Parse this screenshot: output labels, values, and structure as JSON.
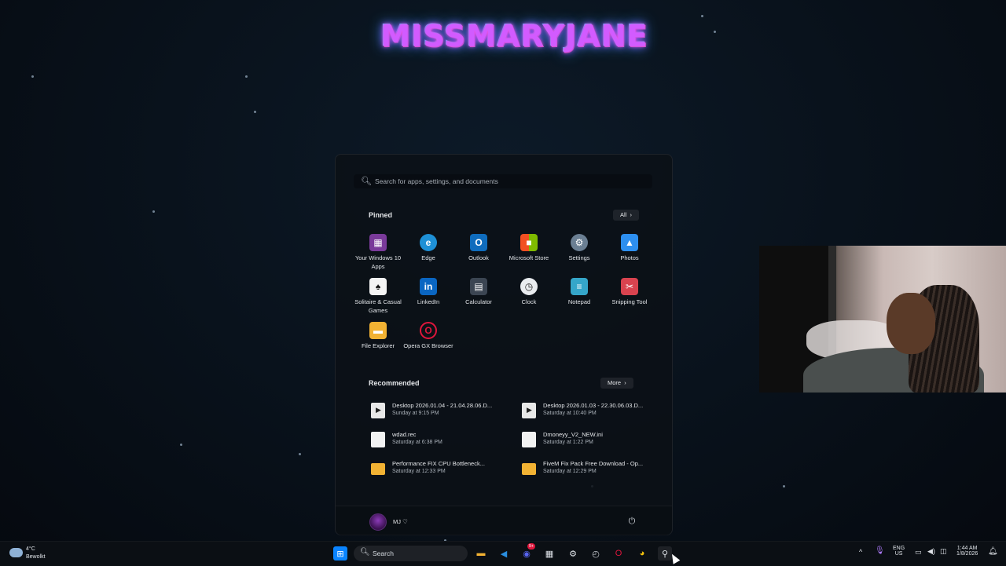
{
  "stream_title": "MISSMARYJANE",
  "start_menu": {
    "search": {
      "placeholder": "Search for apps, settings, and documents"
    },
    "pinned": {
      "title": "Pinned",
      "all_label": "All",
      "apps": [
        {
          "label": "Your Windows 10 Apps",
          "icon": "windows-apps-icon",
          "color": "#7a3a9a"
        },
        {
          "label": "Edge",
          "icon": "edge-icon",
          "color": "#1e90d6"
        },
        {
          "label": "Outlook",
          "icon": "outlook-icon",
          "color": "#0f6cbd"
        },
        {
          "label": "Microsoft Store",
          "icon": "store-icon",
          "color": "#f25022"
        },
        {
          "label": "Settings",
          "icon": "gear-icon",
          "color": "#6b7f93"
        },
        {
          "label": "Photos",
          "icon": "photos-icon",
          "color": "#2d8ff0"
        },
        {
          "label": "Solitaire & Casual Games",
          "icon": "solitaire-icon",
          "color": "#1f6e3a"
        },
        {
          "label": "LinkedIn",
          "icon": "linkedin-icon",
          "color": "#0a66c2"
        },
        {
          "label": "Calculator",
          "icon": "calculator-icon",
          "color": "#3b4552"
        },
        {
          "label": "Clock",
          "icon": "clock-icon",
          "color": "#5f6670"
        },
        {
          "label": "Notepad",
          "icon": "notepad-icon",
          "color": "#35a6c9"
        },
        {
          "label": "Snipping Tool",
          "icon": "snipping-tool-icon",
          "color": "#d9434f"
        },
        {
          "label": "File Explorer",
          "icon": "folder-icon",
          "color": "#f2b233"
        },
        {
          "label": "Opera GX Browser",
          "icon": "opera-gx-icon",
          "color": "#e0163c"
        }
      ]
    },
    "recommended": {
      "title": "Recommended",
      "more_label": "More",
      "items": [
        {
          "name": "Desktop 2026.01.04 - 21.04.28.06.D...",
          "time": "Sunday at 9:15 PM",
          "icon": "video-file-icon"
        },
        {
          "name": "Desktop 2026.01.03 - 22.30.06.03.D...",
          "time": "Saturday at 10:40 PM",
          "icon": "video-file-icon"
        },
        {
          "name": "wdad.rec",
          "time": "Saturday at 6:38 PM",
          "icon": "file-icon"
        },
        {
          "name": "Dmoneyy_V2_NEW.ini",
          "time": "Saturday at 1:22 PM",
          "icon": "file-icon"
        },
        {
          "name": "Performance FIX CPU Bottleneck...",
          "time": "Saturday at 12:33 PM",
          "icon": "folder-icon"
        },
        {
          "name": "FiveM Fix Pack Free Download - Op...",
          "time": "Saturday at 12:29 PM",
          "icon": "folder-icon"
        }
      ]
    },
    "user": {
      "name": "MJ ♡"
    }
  },
  "taskbar": {
    "weather": {
      "temp": "4°C",
      "desc": "Bewolkt"
    },
    "search_label": "Search",
    "badge_count": "9+",
    "language": {
      "line1": "ENG",
      "line2": "US"
    },
    "clock": {
      "time": "1:44 AM",
      "date": "1/8/2026"
    }
  }
}
